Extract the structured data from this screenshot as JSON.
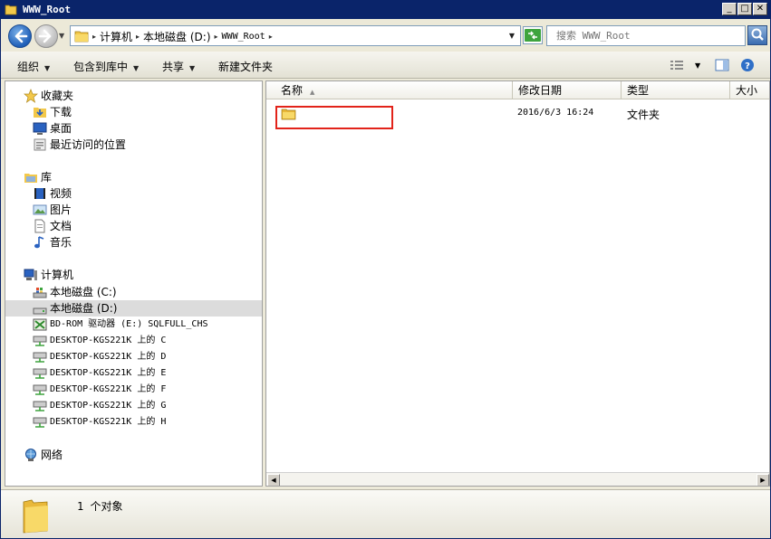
{
  "window": {
    "title": "WWW_Root",
    "min_glyph": "_",
    "max_glyph": "□",
    "close_glyph": "✕"
  },
  "address": {
    "crumbs": [
      "计算机",
      "本地磁盘 (D:)",
      "WWW_Root"
    ],
    "search_placeholder": "搜索 WWW_Root"
  },
  "toolbar": {
    "organize": "组织",
    "include_in_library": "包含到库中",
    "share": "共享",
    "new_folder": "新建文件夹"
  },
  "navigation": {
    "favorites_header": "收藏夹",
    "favorites": [
      "下载",
      "桌面",
      "最近访问的位置"
    ],
    "libraries_header": "库",
    "libraries": [
      "视频",
      "图片",
      "文档",
      "音乐"
    ],
    "computer_header": "计算机",
    "drives": [
      "本地磁盘 (C:)",
      "本地磁盘 (D:)",
      "BD-ROM 驱动器 (E:) SQLFULL_CHS",
      "DESKTOP-KGS221K 上的 C",
      "DESKTOP-KGS221K 上的 D",
      "DESKTOP-KGS221K 上的 E",
      "DESKTOP-KGS221K 上的 F",
      "DESKTOP-KGS221K 上的 G",
      "DESKTOP-KGS221K 上的 H"
    ],
    "network_header": "网络",
    "selected_drive": "本地磁盘 (D:)"
  },
  "columns": {
    "name": "名称",
    "modified": "修改日期",
    "type": "类型",
    "size": "大小"
  },
  "files": [
    {
      "name": "",
      "modified": "2016/6/3 16:24",
      "type": "文件夹"
    }
  ],
  "status": {
    "count": "1 个对象"
  },
  "colors": {
    "titlebar": "#0a246a",
    "highlight_box": "#e2231a",
    "selection": "#dcdcdc"
  }
}
